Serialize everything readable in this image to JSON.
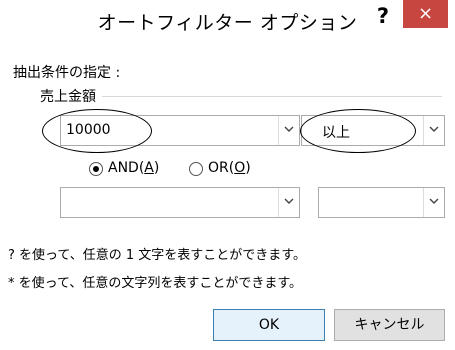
{
  "window": {
    "title": "オートフィルター オプション",
    "help_label": "?",
    "close_label": "×"
  },
  "criteria": {
    "section_label": "抽出条件の指定 :",
    "field_label": "売上金額",
    "condition1": {
      "value": "10000",
      "operator": "以上"
    },
    "logic": {
      "and_label": "AND(",
      "and_key": "A",
      "and_close": ")",
      "or_label": "OR(",
      "or_key": "O",
      "or_close": ")",
      "selected": "AND"
    },
    "condition2": {
      "value": "",
      "operator": ""
    }
  },
  "help": {
    "line1": "? を使って、任意の 1 文字を表すことができます。",
    "line2": "* を使って、任意の文字列を表すことができます。"
  },
  "buttons": {
    "ok": "OK",
    "cancel": "キャンセル"
  }
}
